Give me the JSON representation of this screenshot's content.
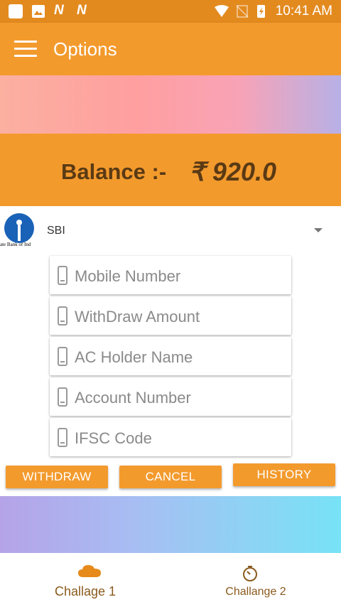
{
  "status_bar": {
    "time": "10:41 AM",
    "notif_1": "N",
    "notif_2": "N"
  },
  "app_bar": {
    "title": "Options"
  },
  "balance": {
    "label": "Balance :-",
    "value": "₹ 920.0"
  },
  "bank": {
    "logo_caption": "ate Bank of Ind",
    "selected": "SBI"
  },
  "form": {
    "fields": [
      {
        "placeholder": "Mobile Number"
      },
      {
        "placeholder": "WithDraw Amount"
      },
      {
        "placeholder": "AC Holder Name"
      },
      {
        "placeholder": "Account Number"
      },
      {
        "placeholder": "IFSC Code"
      }
    ]
  },
  "buttons": {
    "withdraw": "WITHDRAW",
    "cancel": "CANCEL",
    "history": "HISTORY"
  },
  "bottom_nav": {
    "items": [
      {
        "label": "Challage 1",
        "icon": "cloud-icon"
      },
      {
        "label": "Challange 2",
        "icon": "timer-icon"
      }
    ]
  },
  "colors": {
    "accent": "#f39a2d",
    "status_bar": "#e38a1f",
    "balance_text": "#5a3a14"
  }
}
